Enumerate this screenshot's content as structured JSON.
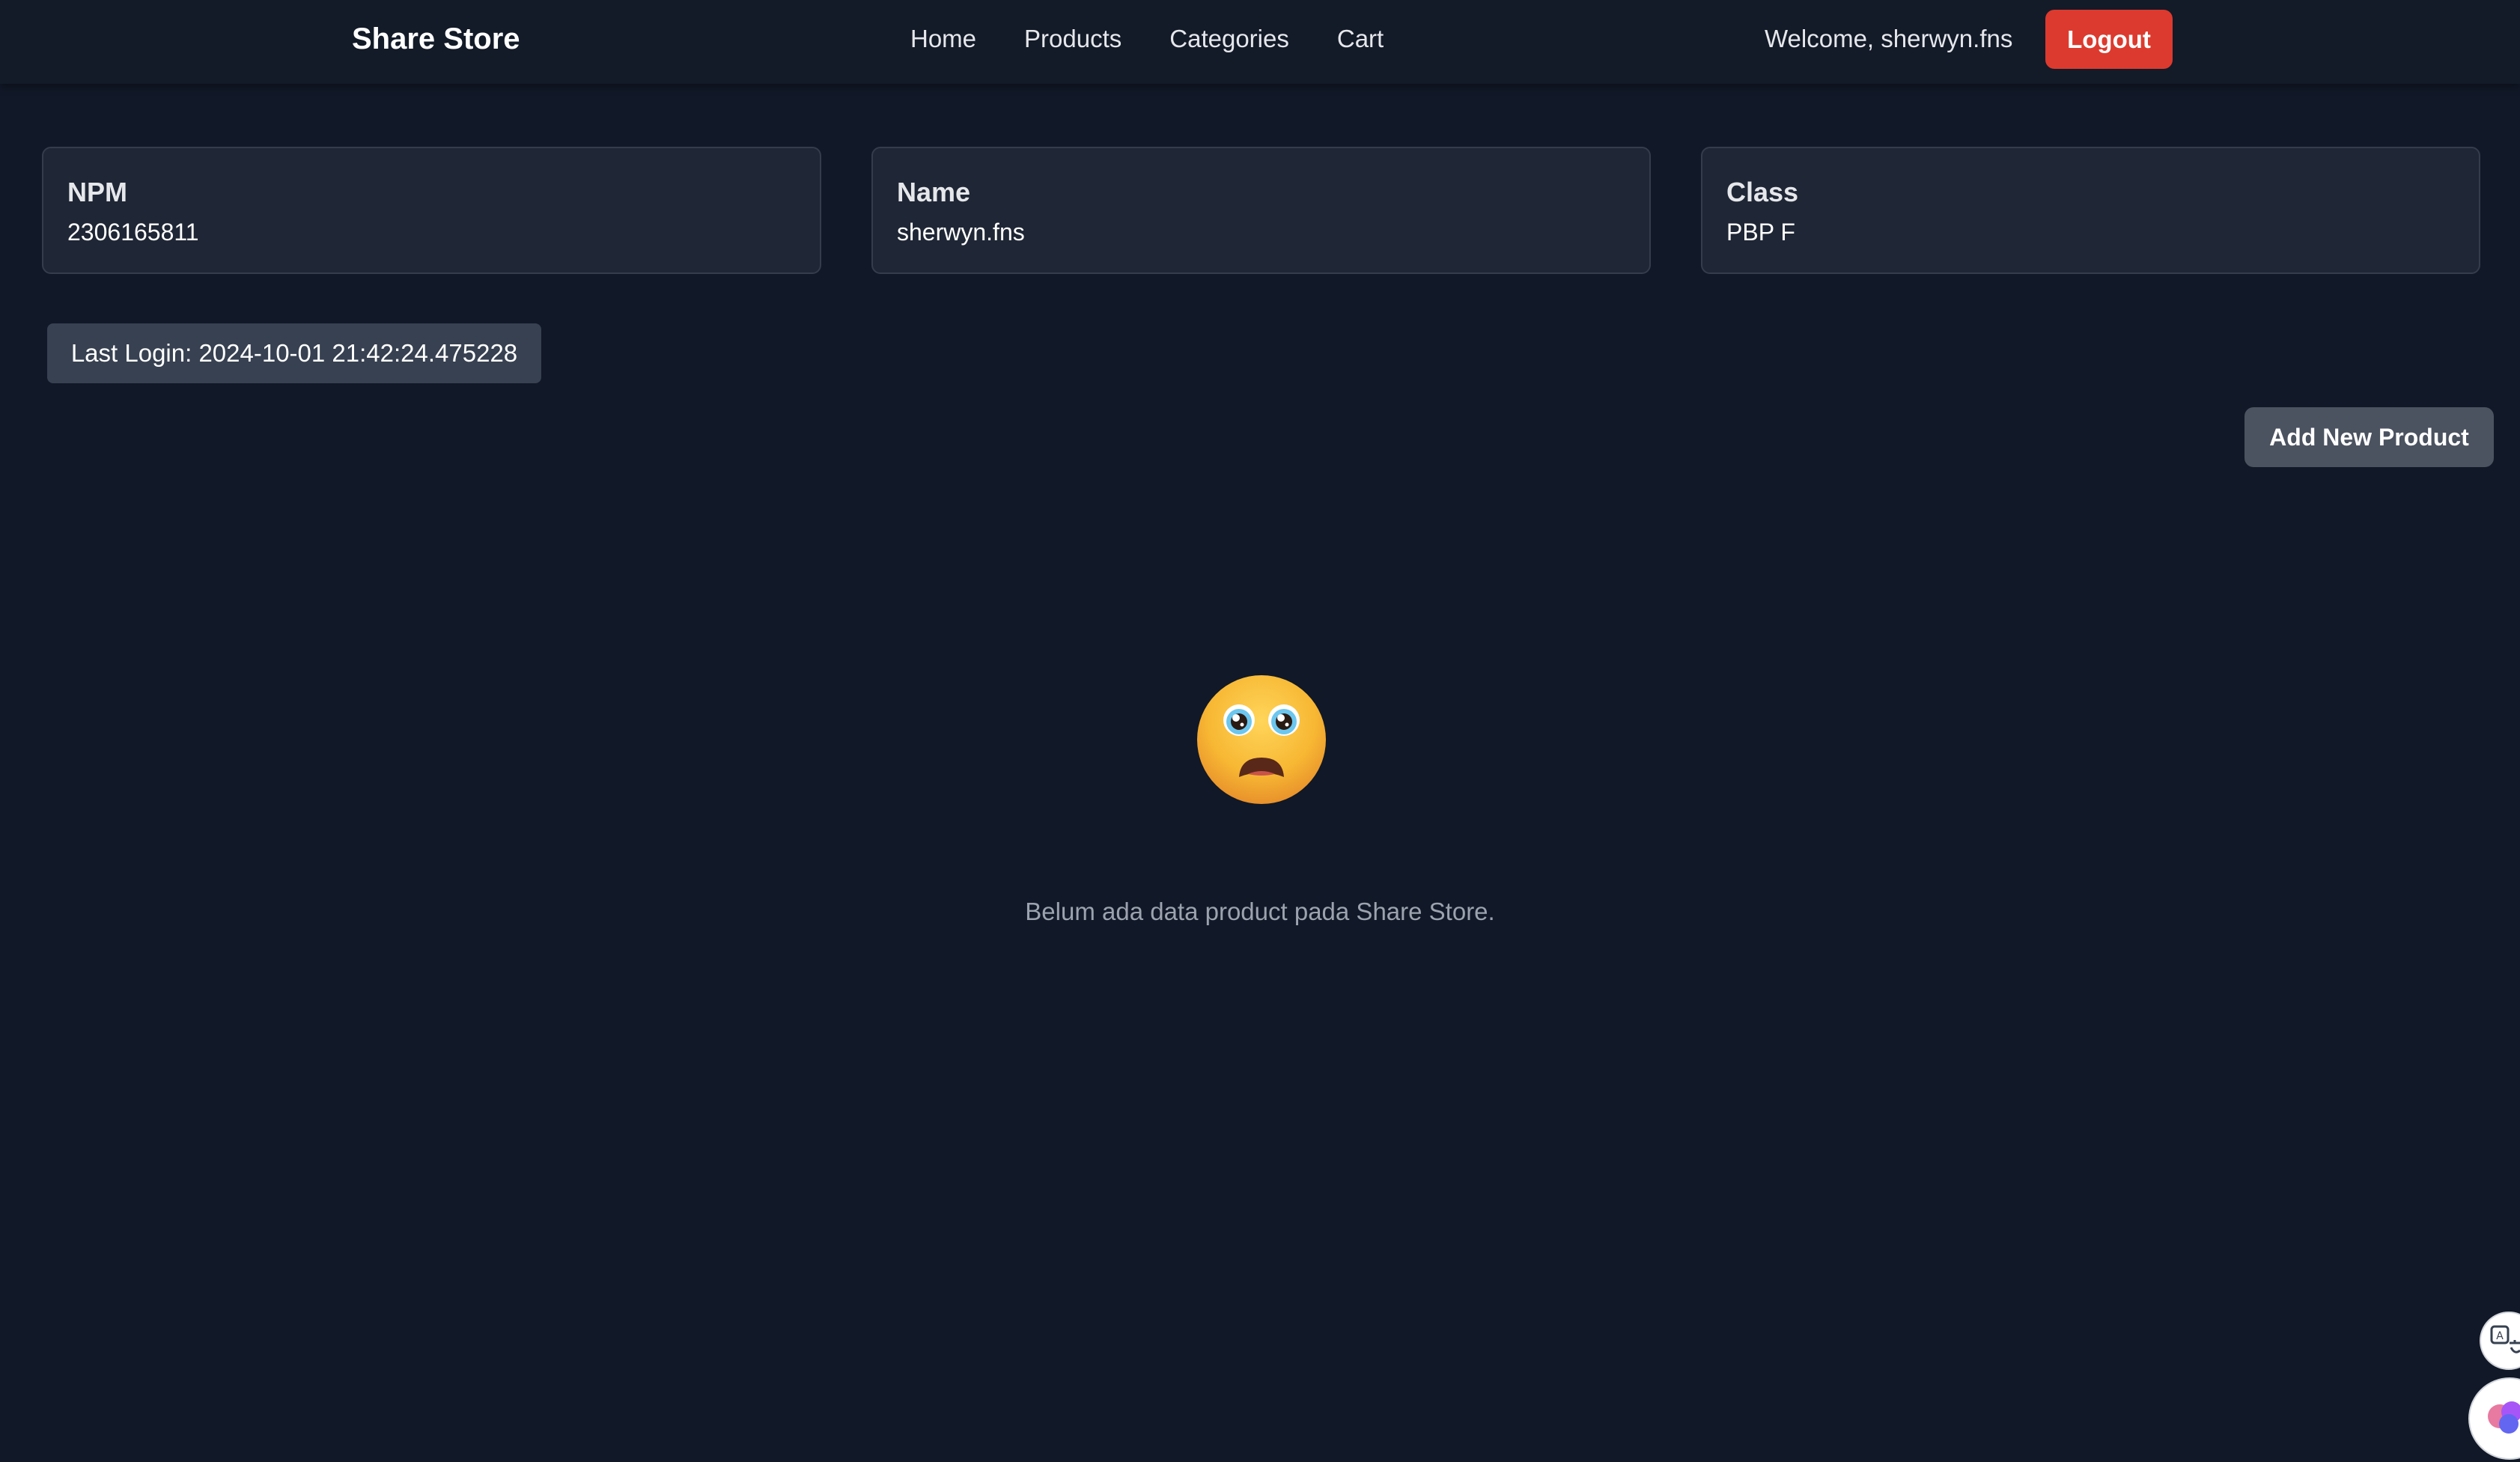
{
  "navbar": {
    "brand": "Share Store",
    "links": [
      "Home",
      "Products",
      "Categories",
      "Cart"
    ],
    "welcome": "Welcome, sherwyn.fns",
    "logout_label": "Logout",
    "logout_color": "#dc3a2e"
  },
  "cards": {
    "npm": {
      "title": "NPM",
      "value": "2306165811"
    },
    "name": {
      "title": "Name",
      "value": "sherwyn.fns"
    },
    "class": {
      "title": "Class",
      "value": "PBP F"
    }
  },
  "last_login": "Last Login: 2024-10-01 21:42:24.475228",
  "add_product_label": "Add New Product",
  "empty_state": {
    "icon": "crying-face-icon",
    "message": "Belum ada data product pada Share Store."
  },
  "floating_widgets": {
    "translate_icon": "translate-icon",
    "assistant_icon": "assistant-icon"
  },
  "colors": {
    "background": "#111827",
    "card_background": "#1f2635",
    "muted_text": "#9ca3af"
  }
}
